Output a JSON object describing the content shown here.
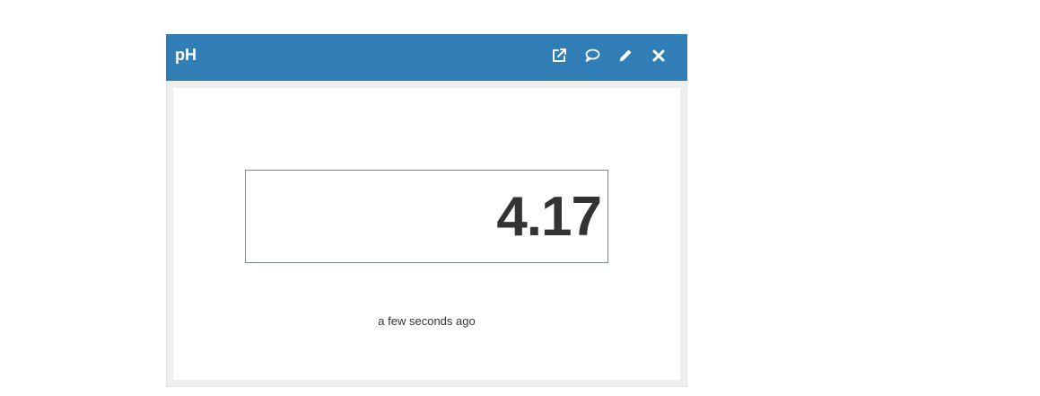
{
  "widget": {
    "title": "pH",
    "value": "4.17",
    "updated": "a few seconds ago",
    "actions": [
      {
        "name": "open-external-icon"
      },
      {
        "name": "comment-icon"
      },
      {
        "name": "edit-pencil-icon"
      },
      {
        "name": "close-icon"
      }
    ]
  },
  "colors": {
    "header": "#317db5",
    "value_text": "#333333",
    "value_border": "#7a8b98"
  }
}
